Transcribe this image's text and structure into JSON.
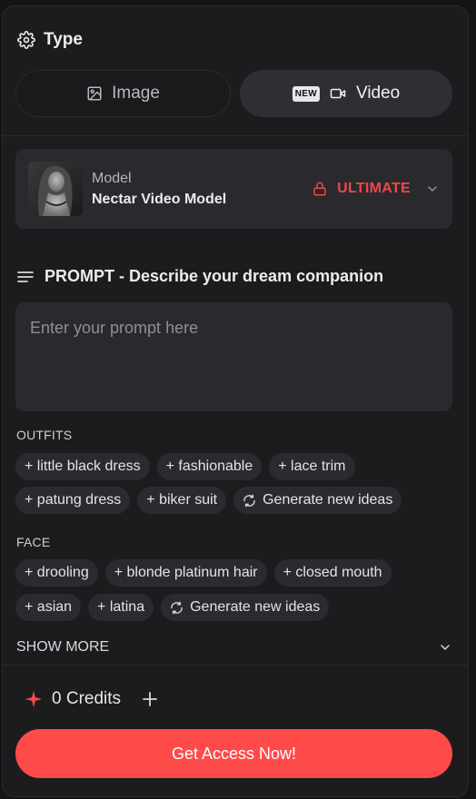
{
  "type_section": {
    "title": "Type",
    "icon": "gear-icon",
    "options": [
      {
        "label": "Image",
        "icon": "image-icon",
        "selected": false
      },
      {
        "label": "Video",
        "icon": "video-camera-icon",
        "badge": "NEW",
        "selected": true
      }
    ]
  },
  "model": {
    "label": "Model",
    "name": "Nectar Video Model",
    "tier": "ULTIMATE",
    "tier_icon": "lock-icon",
    "tier_color": "#ef4747"
  },
  "prompt": {
    "title": "PROMPT - Describe your dream companion",
    "placeholder": "Enter your prompt here",
    "value": ""
  },
  "outfits": {
    "label": "OUTFITS",
    "chips_row1": [
      "+ little black dress",
      "+ fashionable",
      "+ lace trim"
    ],
    "chips_row2": [
      "+ patung dress",
      "+ biker suit"
    ],
    "generate_label": "Generate new ideas"
  },
  "face": {
    "label": "FACE",
    "chips_row1": [
      "+ drooling",
      "+ blonde platinum hair",
      "+ closed mouth"
    ],
    "chips_row2": [
      "+ asian",
      "+ latina"
    ],
    "generate_label": "Generate new ideas"
  },
  "show_more": {
    "label": "SHOW MORE"
  },
  "credits": {
    "text": "0 Credits",
    "icon": "sparkle-icon",
    "accent": "#ff4a4a"
  },
  "cta": {
    "label": "Get Access Now!",
    "color": "#ff4a4a"
  }
}
